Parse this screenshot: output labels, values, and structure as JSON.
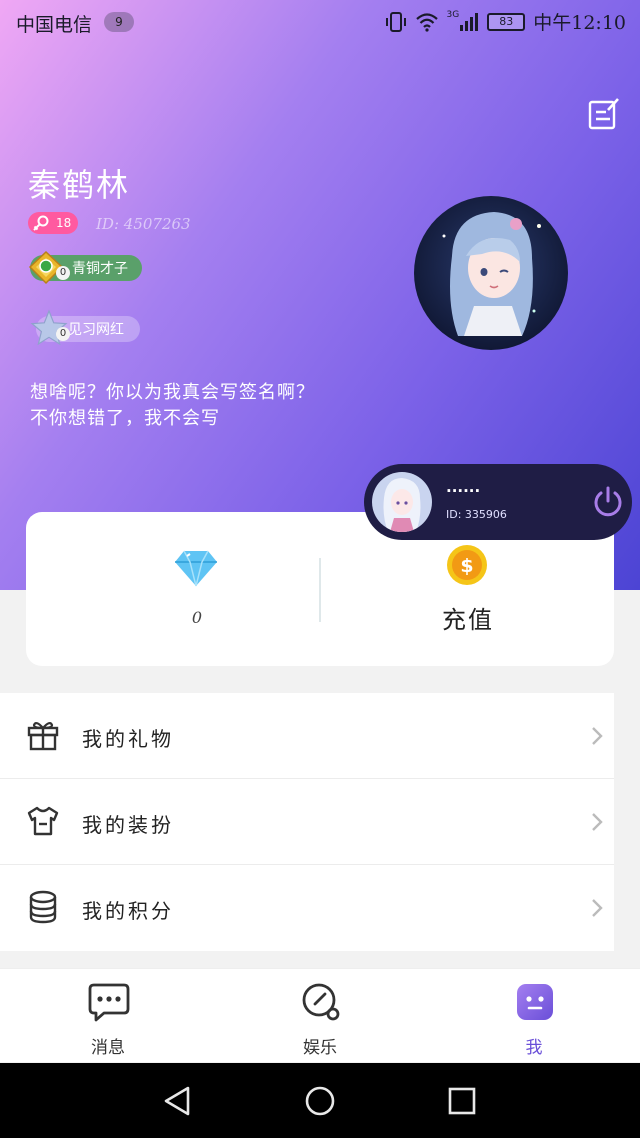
{
  "status_bar": {
    "carrier": "中国电信",
    "notification_count": "9",
    "network_type": "3G",
    "battery": "83",
    "time": "中午12:10"
  },
  "profile": {
    "username": "秦鹤林",
    "age": "18",
    "user_id": "ID: 4507263",
    "level": {
      "count": "0",
      "label": "青铜才子"
    },
    "fame": {
      "count": "0",
      "label": "见习网红"
    },
    "signature_line1": "想啥呢？你以为我真会写签名啊？",
    "signature_line2": "不你想错了，我不会写"
  },
  "mini_player": {
    "name": "······",
    "id": "ID: 335906"
  },
  "wallet": {
    "diamonds": "0",
    "recharge_label": "充值"
  },
  "menu": [
    {
      "label": "我的礼物",
      "icon": "gift-icon"
    },
    {
      "label": "我的装扮",
      "icon": "shirt-icon"
    },
    {
      "label": "我的积分",
      "icon": "coins-icon"
    }
  ],
  "tabs": [
    {
      "label": "消息",
      "icon": "message-icon"
    },
    {
      "label": "娱乐",
      "icon": "search-icon"
    },
    {
      "label": "我",
      "icon": "me-icon",
      "active": true
    }
  ],
  "colors": {
    "accent": "#6a4fd8",
    "gradient_start": "#f0a8f4",
    "gradient_end": "#4c44d4",
    "level_badge": "#5aa06a",
    "mini_player_bg": "#1f1d45"
  }
}
